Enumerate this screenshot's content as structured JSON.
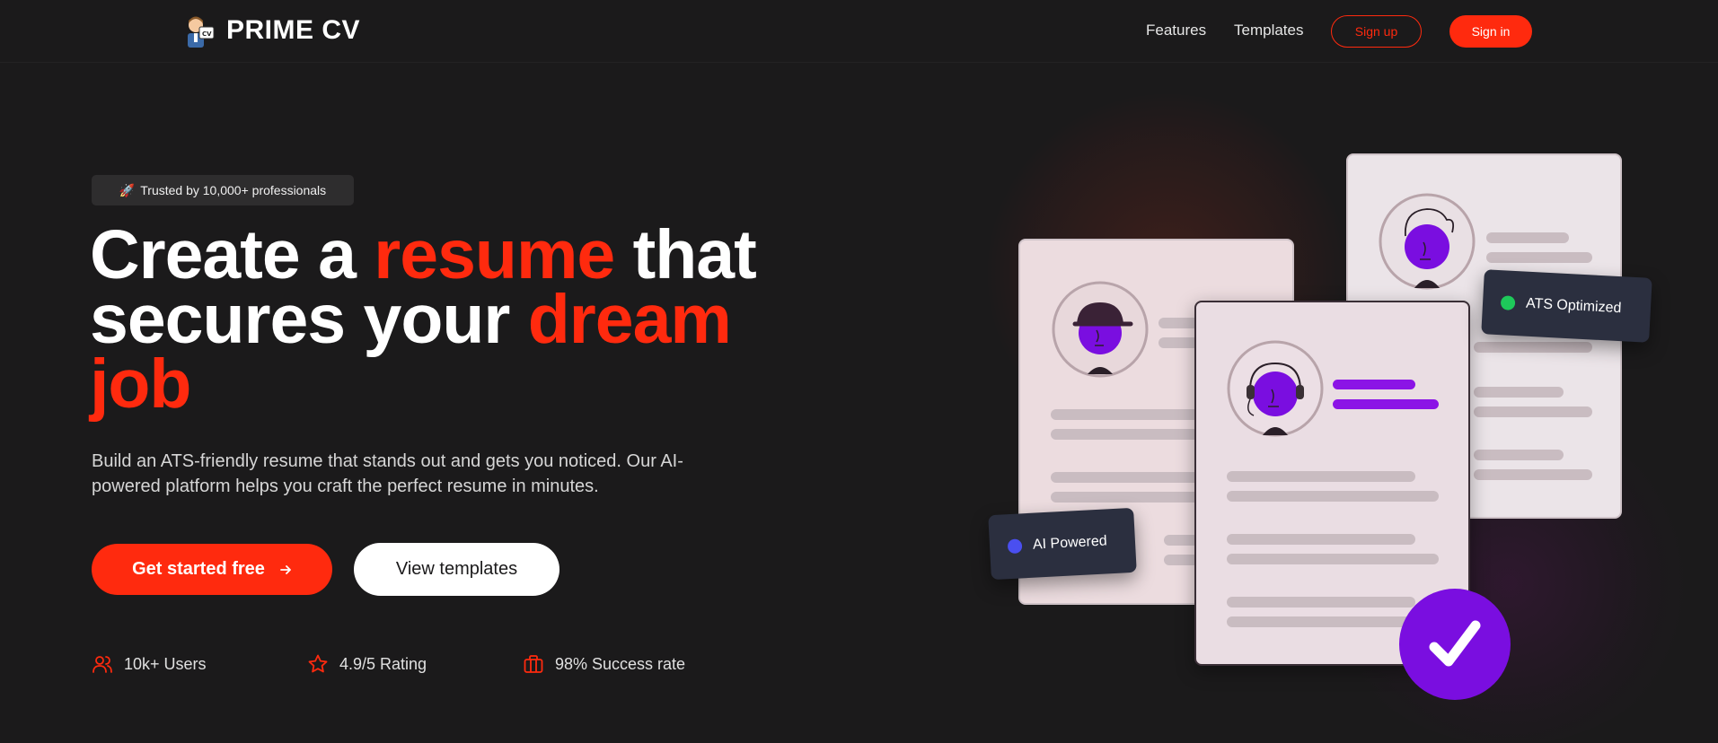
{
  "brand": {
    "name": "PRIME CV",
    "logo_icon": "cv-character-logo-icon"
  },
  "nav": {
    "links": [
      "Features",
      "Templates"
    ],
    "signup_label": "Sign up",
    "signin_label": "Sign in"
  },
  "hero": {
    "badge_icon": "🚀",
    "badge_text": "Trusted by 10,000+ professionals",
    "headline": {
      "part1": "Create a ",
      "accent1": "resume",
      "part2": " that secures your ",
      "accent2": "dream job"
    },
    "subtext": "Build an ATS-friendly resume that stands out and gets you noticed. Our AI-powered platform helps you craft the perfect resume in minutes.",
    "primary_cta": "Get started free",
    "primary_cta_icon": "arrow-right-icon",
    "secondary_cta": "View templates",
    "stats": [
      {
        "icon": "users-icon",
        "label": "10k+ Users"
      },
      {
        "icon": "star-icon",
        "label": "4.9/5 Rating"
      },
      {
        "icon": "briefcase-icon",
        "label": "98% Success rate"
      }
    ]
  },
  "illustration": {
    "chip_ai": "AI Powered",
    "chip_ats": "ATS Optimized",
    "chip_ai_dot_color": "#4a4ff0",
    "chip_ats_dot_color": "#1ec95a",
    "check_icon": "checkmark-icon"
  },
  "colors": {
    "background": "#1b1a1b",
    "accent": "#ff2a0e",
    "purple": "#7a0ee0"
  }
}
